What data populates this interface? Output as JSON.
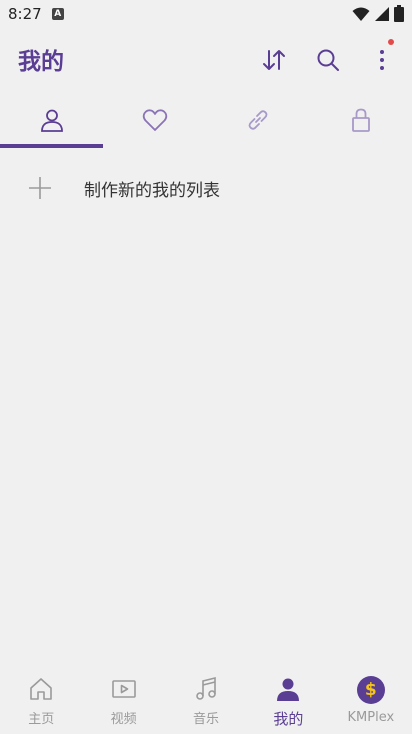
{
  "status": {
    "time": "8:27",
    "app_icon_label": "A"
  },
  "header": {
    "title": "我的"
  },
  "tabs": [
    {
      "icon": "person-icon"
    },
    {
      "icon": "heart-icon"
    },
    {
      "icon": "link-icon"
    },
    {
      "icon": "lock-icon"
    }
  ],
  "create": {
    "label": "制作新的我的列表"
  },
  "bottom_nav": [
    {
      "label": "主页",
      "icon": "home-icon"
    },
    {
      "label": "视频",
      "icon": "video-icon"
    },
    {
      "label": "音乐",
      "icon": "music-icon"
    },
    {
      "label": "我的",
      "icon": "person-icon"
    },
    {
      "label": "KMPlex",
      "icon": "dollar-icon"
    }
  ],
  "colors": {
    "accent": "#5a3e94",
    "background": "#f1f0f1",
    "notification": "#e34b4b",
    "kmplex_glyph": "#f5c518"
  }
}
